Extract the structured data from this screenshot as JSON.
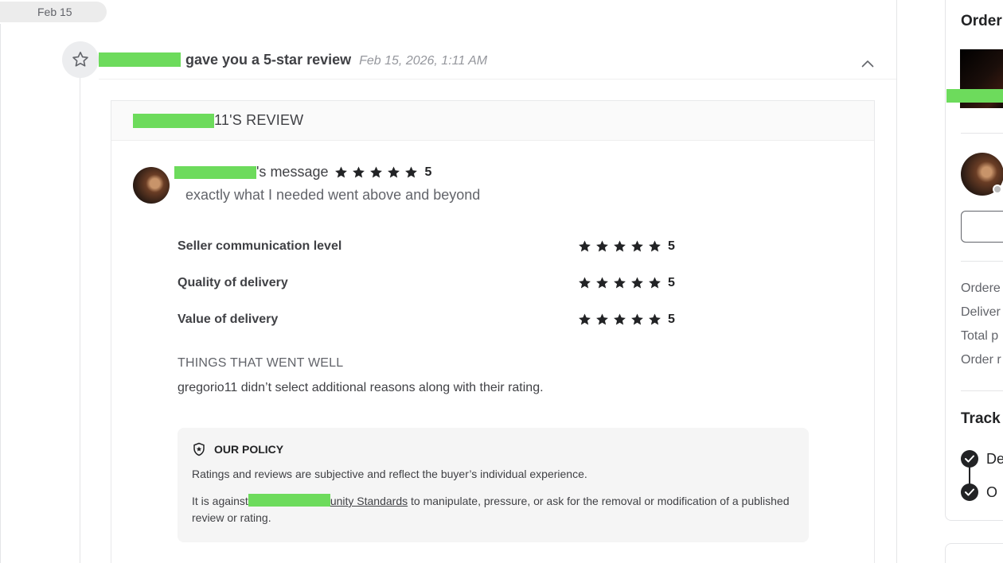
{
  "timeline": {
    "date_pill": "Feb 15"
  },
  "event": {
    "title_suffix": "gave you a 5-star review",
    "timestamp": "Feb 15, 2026, 1:11 AM",
    "icon": "star-outline-icon",
    "collapse_icon": "chevron-up-icon"
  },
  "review": {
    "header_suffix": "11'S REVIEW",
    "message_suffix": "'s message",
    "overall_score": "5",
    "message": "exactly what I needed went above and beyond",
    "ratings": [
      {
        "label": "Seller communication level",
        "score": "5",
        "stars": 5
      },
      {
        "label": "Quality of delivery",
        "score": "5",
        "stars": 5
      },
      {
        "label": "Value of delivery",
        "score": "5",
        "stars": 5
      }
    ],
    "went_well_title": "THINGS THAT WENT WELL",
    "went_well_body": "gregorio11 didn’t select additional reasons along with their rating."
  },
  "policy": {
    "title": "OUR POLICY",
    "icon": "shield-star-icon",
    "line1": "Ratings and reviews are subjective and reflect the buyer’s individual experience.",
    "line2_prefix": "It is against",
    "line2_link": "unity Standards",
    "line2_suffix": " to manipulate, pressure, or ask for the removal or modification of a published review or rating."
  },
  "sidebar": {
    "order_title": "Order",
    "fields": [
      "Ordere",
      "Deliver",
      "Total p",
      "Order r"
    ],
    "track_title": "Track",
    "steps": [
      "De",
      "O"
    ]
  },
  "colors": {
    "redaction": "#6ddb5c",
    "star": "#222325",
    "text": "#404145"
  }
}
